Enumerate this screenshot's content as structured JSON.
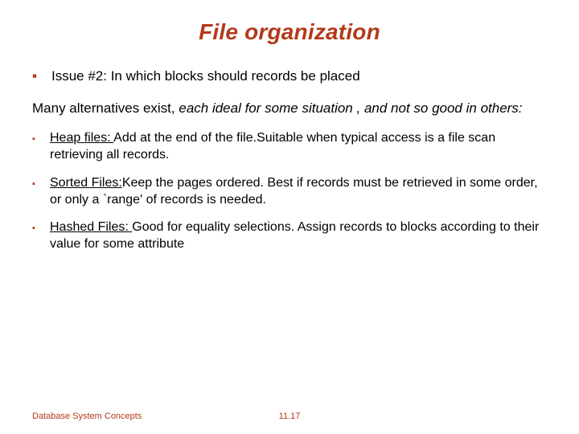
{
  "title": "File organization",
  "issue": "Issue #2: In which blocks should records be placed",
  "intro_plain": "Many alternatives exist, ",
  "intro_em": "each ideal for some situation",
  "intro_em2": ", and not so good in others:",
  "items": [
    {
      "label": "Heap files: ",
      "rest": " Add at the end of the file.Suitable when typical access is a file scan retrieving all records."
    },
    {
      "label": "Sorted Files:",
      "rest": "Keep the pages ordered. Best if records must be retrieved in some order, or only a `range' of records is needed."
    },
    {
      "label": "Hashed Files: ",
      "rest": "Good for equality selections. Assign records to blocks according to their value for some attribute"
    }
  ],
  "footer": {
    "left": "Database System Concepts",
    "center": "11.17"
  }
}
